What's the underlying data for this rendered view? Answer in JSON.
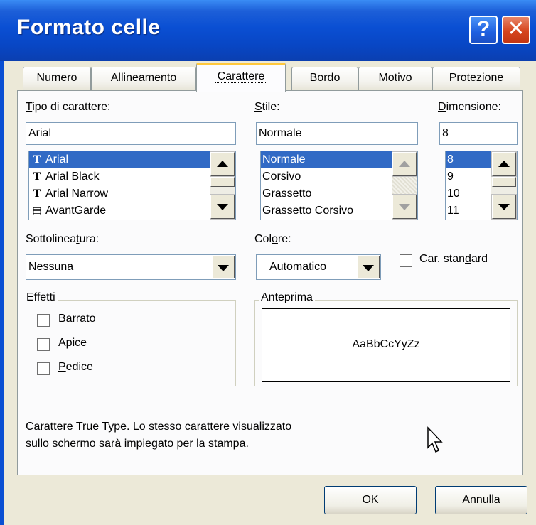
{
  "window": {
    "title": "Formato celle",
    "help_label": "?",
    "close_label": "✕"
  },
  "tabs": [
    "Numero",
    "Allineamento",
    "Carattere",
    "Bordo",
    "Motivo",
    "Protezione"
  ],
  "active_tab": "Carattere",
  "font": {
    "label_pre": "",
    "label_u": "T",
    "label_post": "ipo di carattere:",
    "value": "Arial",
    "items": [
      "Arial",
      "Arial Black",
      "Arial Narrow",
      "AvantGarde"
    ],
    "item_icons": [
      "truetype-icon",
      "truetype-icon",
      "truetype-icon",
      "printer-font-icon"
    ]
  },
  "style": {
    "label_pre": "",
    "label_u": "S",
    "label_post": "tile:",
    "value": "Normale",
    "items": [
      "Normale",
      "Corsivo",
      "Grassetto",
      "Grassetto Corsivo"
    ]
  },
  "size": {
    "label_pre": "",
    "label_u": "D",
    "label_post": "imensione:",
    "value": "8",
    "items": [
      "8",
      "9",
      "10",
      "11"
    ]
  },
  "underline": {
    "label_pre": "Sottolinea",
    "label_u": "t",
    "label_post": "ura:",
    "value": "Nessuna"
  },
  "color": {
    "label_pre": "Col",
    "label_u": "o",
    "label_post": "re:",
    "value": "Automatico"
  },
  "normal_font": {
    "label_pre": "Car. stan",
    "label_u": "d",
    "label_post": "ard"
  },
  "effects": {
    "title": "Effetti",
    "strikethrough": {
      "pre": "Barrat",
      "u": "o",
      "post": ""
    },
    "superscript": {
      "pre": "",
      "u": "A",
      "post": "pice"
    },
    "subscript": {
      "pre": "",
      "u": "P",
      "post": "edice"
    }
  },
  "preview": {
    "title": "Anteprima",
    "sample": "AaBbCcYyZz"
  },
  "description": {
    "line1": "Carattere True Type. Lo stesso carattere visualizzato",
    "line2": "sullo schermo sarà impiegato per la stampa."
  },
  "buttons": {
    "ok": "OK",
    "cancel": "Annulla"
  },
  "colors": {
    "titlebar": "#0a4fd3",
    "selection": "#316ac5",
    "tab_highlight": "#ffc83c"
  }
}
